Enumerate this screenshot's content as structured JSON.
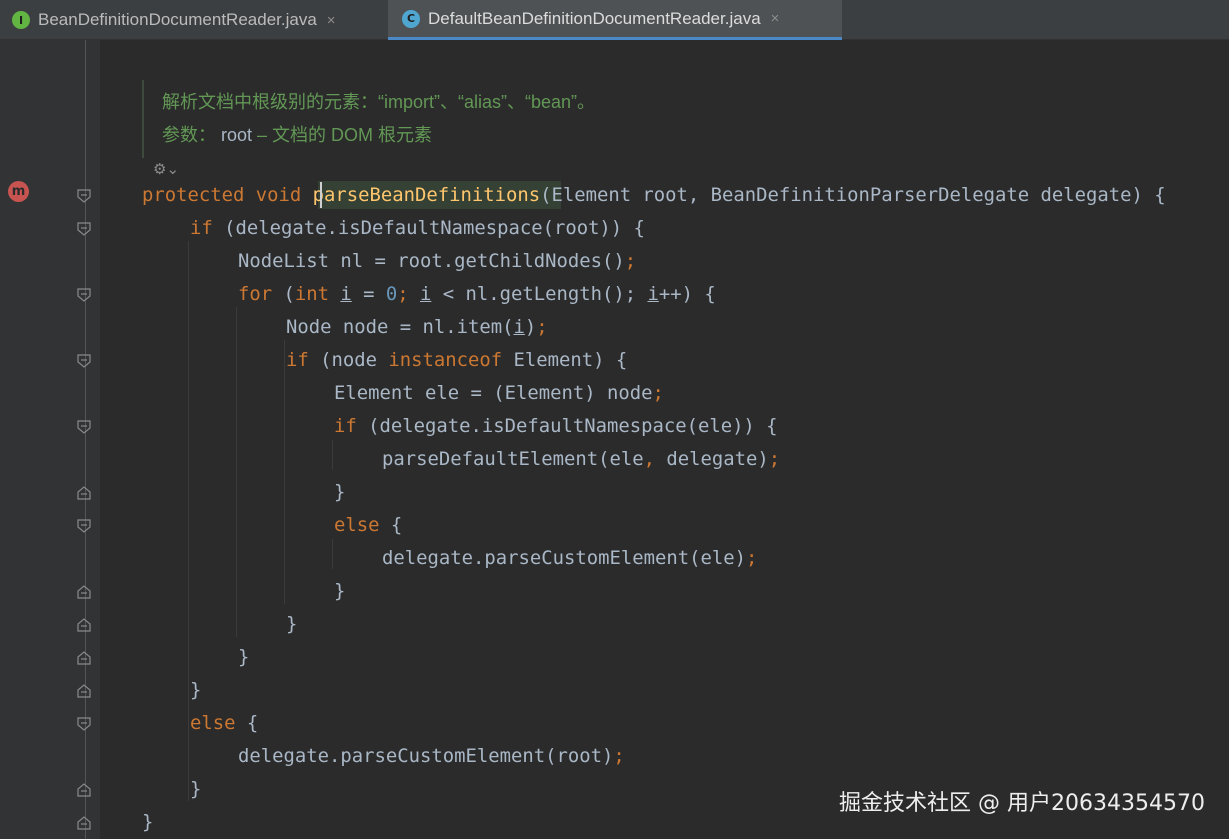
{
  "tabs": [
    {
      "label": "BeanDefinitionDocumentReader.java",
      "icon": "interface-icon",
      "icon_letter": "I",
      "icon_color": "#62b543",
      "close": "×",
      "active": false
    },
    {
      "label": "DefaultBeanDefinitionDocumentReader.java",
      "icon": "class-icon",
      "icon_letter": "C",
      "icon_color": "#4fa7d1",
      "close": "×",
      "active": true
    }
  ],
  "doc_comment": {
    "line1": "解析文档中根级别的元素：“import”、“alias”、“bean”。",
    "param_label": "参数：",
    "param_name": "root",
    "param_desc": " – 文档的 DOM 根元素"
  },
  "gutter": {
    "override_marker": "m",
    "reader_mode_icon": "⚙⌄"
  },
  "code": {
    "l1": {
      "kw1": "protected",
      "kw2": "void",
      "name": "parseBeanDefinitions",
      "rest": "(Element root, BeanDefinitionParserDelegate delegate) {"
    },
    "l2": {
      "kw": "if",
      "rest": " (delegate.isDefaultNamespace(root)) {"
    },
    "l3": {
      "text": "NodeList nl = root.getChildNodes()",
      "semi": ";"
    },
    "l4": {
      "kw": "for",
      "a": " (",
      "kw2": "int",
      "b": " ",
      "v1": "i",
      "c": " = ",
      "num": "0",
      "d": "; ",
      "v2": "i",
      "e": " < nl.getLength(); ",
      "v3": "i",
      "f": "++) {"
    },
    "l5": {
      "a": "Node node = nl.item(",
      "v": "i",
      "b": ")",
      "semi": ";"
    },
    "l6": {
      "kw": "if",
      "a": " (node ",
      "kw2": "instanceof",
      "b": " Element) {"
    },
    "l7": {
      "text": "Element ele = (Element) node",
      "semi": ";"
    },
    "l8": {
      "kw": "if",
      "rest": " (delegate.isDefaultNamespace(ele)) {"
    },
    "l9": {
      "a": "parseDefaultElement(ele",
      "comma": ",",
      "b": " delegate)",
      "semi": ";"
    },
    "l10": {
      "text": "}"
    },
    "l11": {
      "kw": "else",
      "rest": " {"
    },
    "l12": {
      "text": "delegate.parseCustomElement(ele)",
      "semi": ";"
    },
    "l13": {
      "text": "}"
    },
    "l14": {
      "text": "}"
    },
    "l15": {
      "text": "}"
    },
    "l16": {
      "text": "}"
    },
    "l17": {
      "kw": "else",
      "rest": " {"
    },
    "l18": {
      "text": "delegate.parseCustomElement(root)",
      "semi": ";"
    },
    "l19": {
      "text": "}"
    },
    "l20": {
      "text": "}"
    }
  },
  "watermark": "掘金技术社区 @ 用户20634354570",
  "colors": {
    "background": "#2b2b2b",
    "keyword": "#cc7832",
    "method_decl": "#ffc66d",
    "number": "#6897bb",
    "doc_comment": "#629755",
    "text": "#a9b7c6",
    "active_tab_underline": "#4a88c7"
  }
}
